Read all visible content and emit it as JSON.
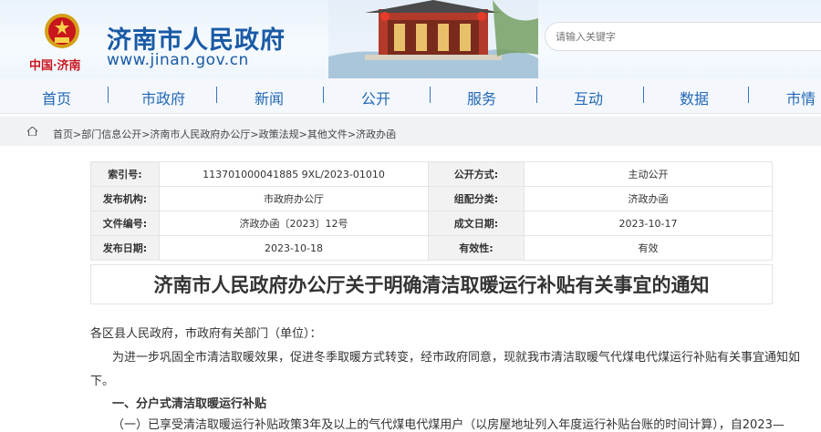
{
  "site": {
    "title": "济南市人民政府",
    "url": "www.jinan.gov.cn",
    "city_logo": "中国·济南"
  },
  "search": {
    "placeholder": "请输入关键字"
  },
  "nav": {
    "items": [
      "首页",
      "市政府",
      "新闻",
      "公开",
      "服务",
      "互动",
      "数据",
      "市情"
    ]
  },
  "breadcrumb": "首页>部门信息公开>济南市人民政府办公厅>政策法规>其他文件>济政办函",
  "info_table": {
    "rows": [
      {
        "label1": "索引号:",
        "value1": "113701000041885 9XL/2023-01010",
        "label2": "公开方式:",
        "value2": "主动公开"
      },
      {
        "label1": "发布机构:",
        "value1": "市政府办公厅",
        "label2": "组配分类:",
        "value2": "济政办函"
      },
      {
        "label1": "文件编号:",
        "value1": "济政办函〔2023〕12号",
        "label2": "成文日期:",
        "value2": "2023-10-17"
      },
      {
        "label1": "发布日期:",
        "value1": "2023-10-18",
        "label2": "有效性:",
        "value2": "有效"
      }
    ]
  },
  "document": {
    "title": "济南市人民政府办公厅关于明确清洁取暖运行补贴有关事宜的通知",
    "salutation": "各区县人民政府，市政府有关部门（单位）：",
    "para1_line1": "为进一步巩固全市清洁取暖效果，促进冬季取暖方式转变，经市政府同意，现就我市清洁取暖气代煤电代煤运行补贴有关事宜通知如",
    "para1_line2": "下。",
    "section1": "一、分户式清洁取暖运行补贴",
    "item1": "（一）已享受清洁取暖运行补贴政策3年及以上的气代煤电代煤用户（以房屋地址列入年度运行补贴台账的时间计算），自2023—"
  },
  "colors": {
    "brand_blue": "#1a5aa6",
    "nav_text": "#2368b5",
    "logo_red": "#c8161d"
  }
}
